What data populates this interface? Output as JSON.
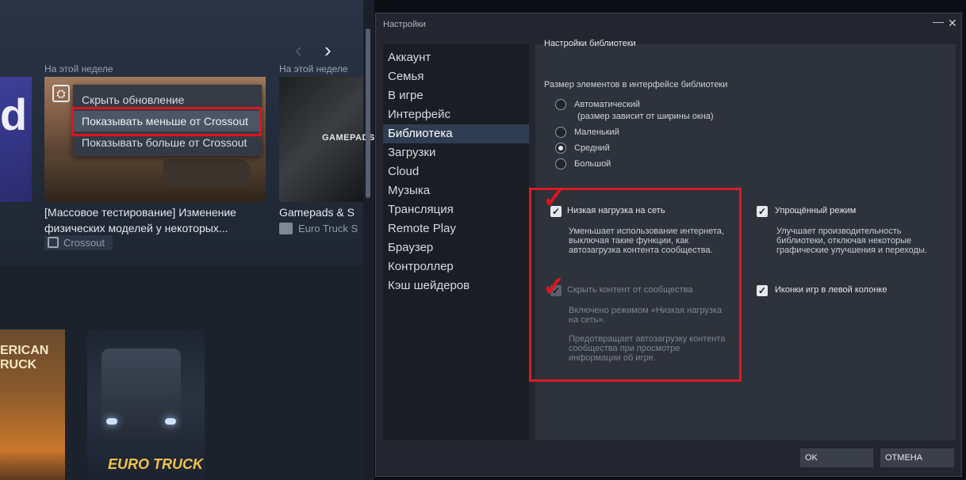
{
  "library": {
    "week_label_1": "На этой неделе",
    "week_label_2": "На этой неделе",
    "thumb_glyph": "d",
    "context_menu": {
      "items": [
        "Скрыть обновление",
        "Показывать меньше от Crossout",
        "Показывать больше от Crossout"
      ]
    },
    "card1": {
      "title": "[Массовое тестирование] Изменение физических моделей у некоторых...",
      "tag": "Crossout"
    },
    "card2": {
      "brand": "GAMEPADS",
      "title": "Gamepads & S",
      "tag": "Euro Truck S"
    },
    "cover1_text": "ERICAN\nRUCK",
    "cover2_text": "EURO TRUCK"
  },
  "window": {
    "title": "Настройки",
    "minimize_glyph": "—",
    "close_glyph": "✕",
    "sidebar": [
      {
        "label": "Аккаунт"
      },
      {
        "label": "Семья"
      },
      {
        "label": "В игре"
      },
      {
        "label": "Интерфейс"
      },
      {
        "label": "Библиотека"
      },
      {
        "label": "Загрузки"
      },
      {
        "label": "Cloud"
      },
      {
        "label": "Музыка"
      },
      {
        "label": "Трансляция"
      },
      {
        "label": "Remote Play"
      },
      {
        "label": "Браузер"
      },
      {
        "label": "Контроллер"
      },
      {
        "label": "Кэш шейдеров"
      }
    ],
    "active_sidebar": "Библиотека",
    "content": {
      "header": "Настройки библиотеки",
      "size_title": "Размер элементов в интерфейсе библиотеки",
      "size_options": [
        {
          "label": "Автоматический",
          "checked": false
        },
        {
          "label": "Маленький",
          "checked": false
        },
        {
          "label": "Средний",
          "checked": true
        },
        {
          "label": "Большой",
          "checked": false
        }
      ],
      "auto_note": "(размер зависит от ширины окна)",
      "low_bandwidth": {
        "label": "Низкая нагрузка на сеть",
        "desc": [
          "Уменьшает использование интернета,",
          "выключая такие функции, как",
          "автозагрузка контента сообщества."
        ]
      },
      "hide_community": {
        "label": "Скрыть контент от сообщества",
        "desc1": [
          "Включено режимом «Низкая нагрузка",
          "на сеть»."
        ],
        "desc2": [
          "Предотвращает автозагрузку контента",
          "сообщества при просмотре",
          "информации об игре."
        ]
      },
      "simplified": {
        "label": "Упрощённый режим",
        "desc": [
          "Улучшает производительность",
          "библиотеки, отключая некоторые",
          "графические улучшения и переходы."
        ]
      },
      "game_icons": {
        "label": "Иконки игр в левой колонке"
      }
    },
    "buttons": {
      "ok": "OK",
      "cancel": "ОТМЕНА"
    }
  },
  "annotations": {
    "highlight_color": "#e0141e"
  }
}
